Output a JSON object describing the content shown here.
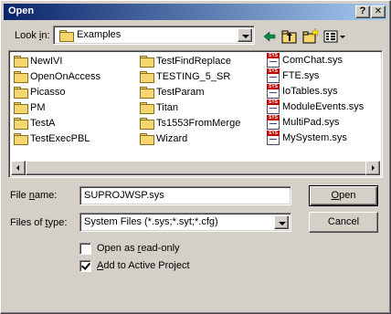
{
  "window": {
    "title": "Open",
    "help_label": "?",
    "close_label": "✕"
  },
  "lookin": {
    "label_pre": "Look ",
    "label_key": "i",
    "label_post": "n:",
    "value": "Examples"
  },
  "toolbar": {
    "icons": [
      "back-arrow-icon",
      "up-folder-icon",
      "new-folder-icon",
      "view-menu-icon"
    ]
  },
  "files": {
    "col1": [
      "NewIVI",
      "OpenOnAccess",
      "Picasso",
      "PM",
      "TestA",
      "TestExecPBL"
    ],
    "col2": [
      "TestFindReplace",
      "TESTING_5_SR",
      "TestParam",
      "Titan",
      "Ts1553FromMerge",
      "Wizard"
    ],
    "col3": [
      "ComChat.sys",
      "FTE.sys",
      "IoTables.sys",
      "ModuleEvents.sys",
      "MultiPad.sys",
      "MySystem.sys"
    ]
  },
  "filename": {
    "label_pre": "File ",
    "label_key": "n",
    "label_post": "ame:",
    "value": "SUPROJWSP.sys"
  },
  "filetype": {
    "label_pre": "Files of ",
    "label_key": "t",
    "label_post": "ype:",
    "value": "System Files (*.sys;*.syt;*.cfg)"
  },
  "buttons": {
    "open_key": "O",
    "open_rest": "pen",
    "cancel": "Cancel"
  },
  "options": {
    "readonly_pre": "Open as ",
    "readonly_key": "r",
    "readonly_post": "ead-only",
    "readonly_checked": false,
    "add_key": "A",
    "add_post": "dd to Active Project",
    "add_checked": true
  }
}
